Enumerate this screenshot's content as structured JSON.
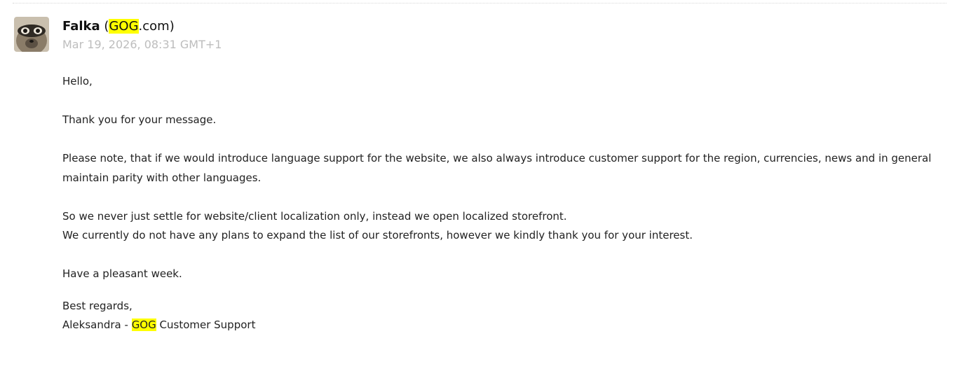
{
  "email": {
    "sender": {
      "name": "Falka",
      "org_open": "(",
      "org_highlight": "GOG",
      "org_rest": ".com)",
      "avatar": "raccoon-avatar"
    },
    "timestamp": "Mar 19, 2026, 08:31 GMT+1",
    "highlight_color": "#ffff00",
    "body": {
      "greeting": "Hello,",
      "thanks": "Thank you for your message.",
      "paragraph_1": "Please note, that if we would introduce language support for the website, we also always introduce customer support for the region, currencies, news and in general maintain parity with other languages.",
      "paragraph_2_line_1": "So we never just settle for website/client localization only, instead we open localized storefront.",
      "paragraph_2_line_2": "We currently do not have any plans to expand the list of our storefronts, however we kindly thank you for your interest.",
      "closing": "Have a pleasant week.",
      "regards": "Best regards,",
      "signature_name": "Aleksandra - ",
      "signature_highlight": "GOG",
      "signature_rest": " Customer Support"
    }
  }
}
